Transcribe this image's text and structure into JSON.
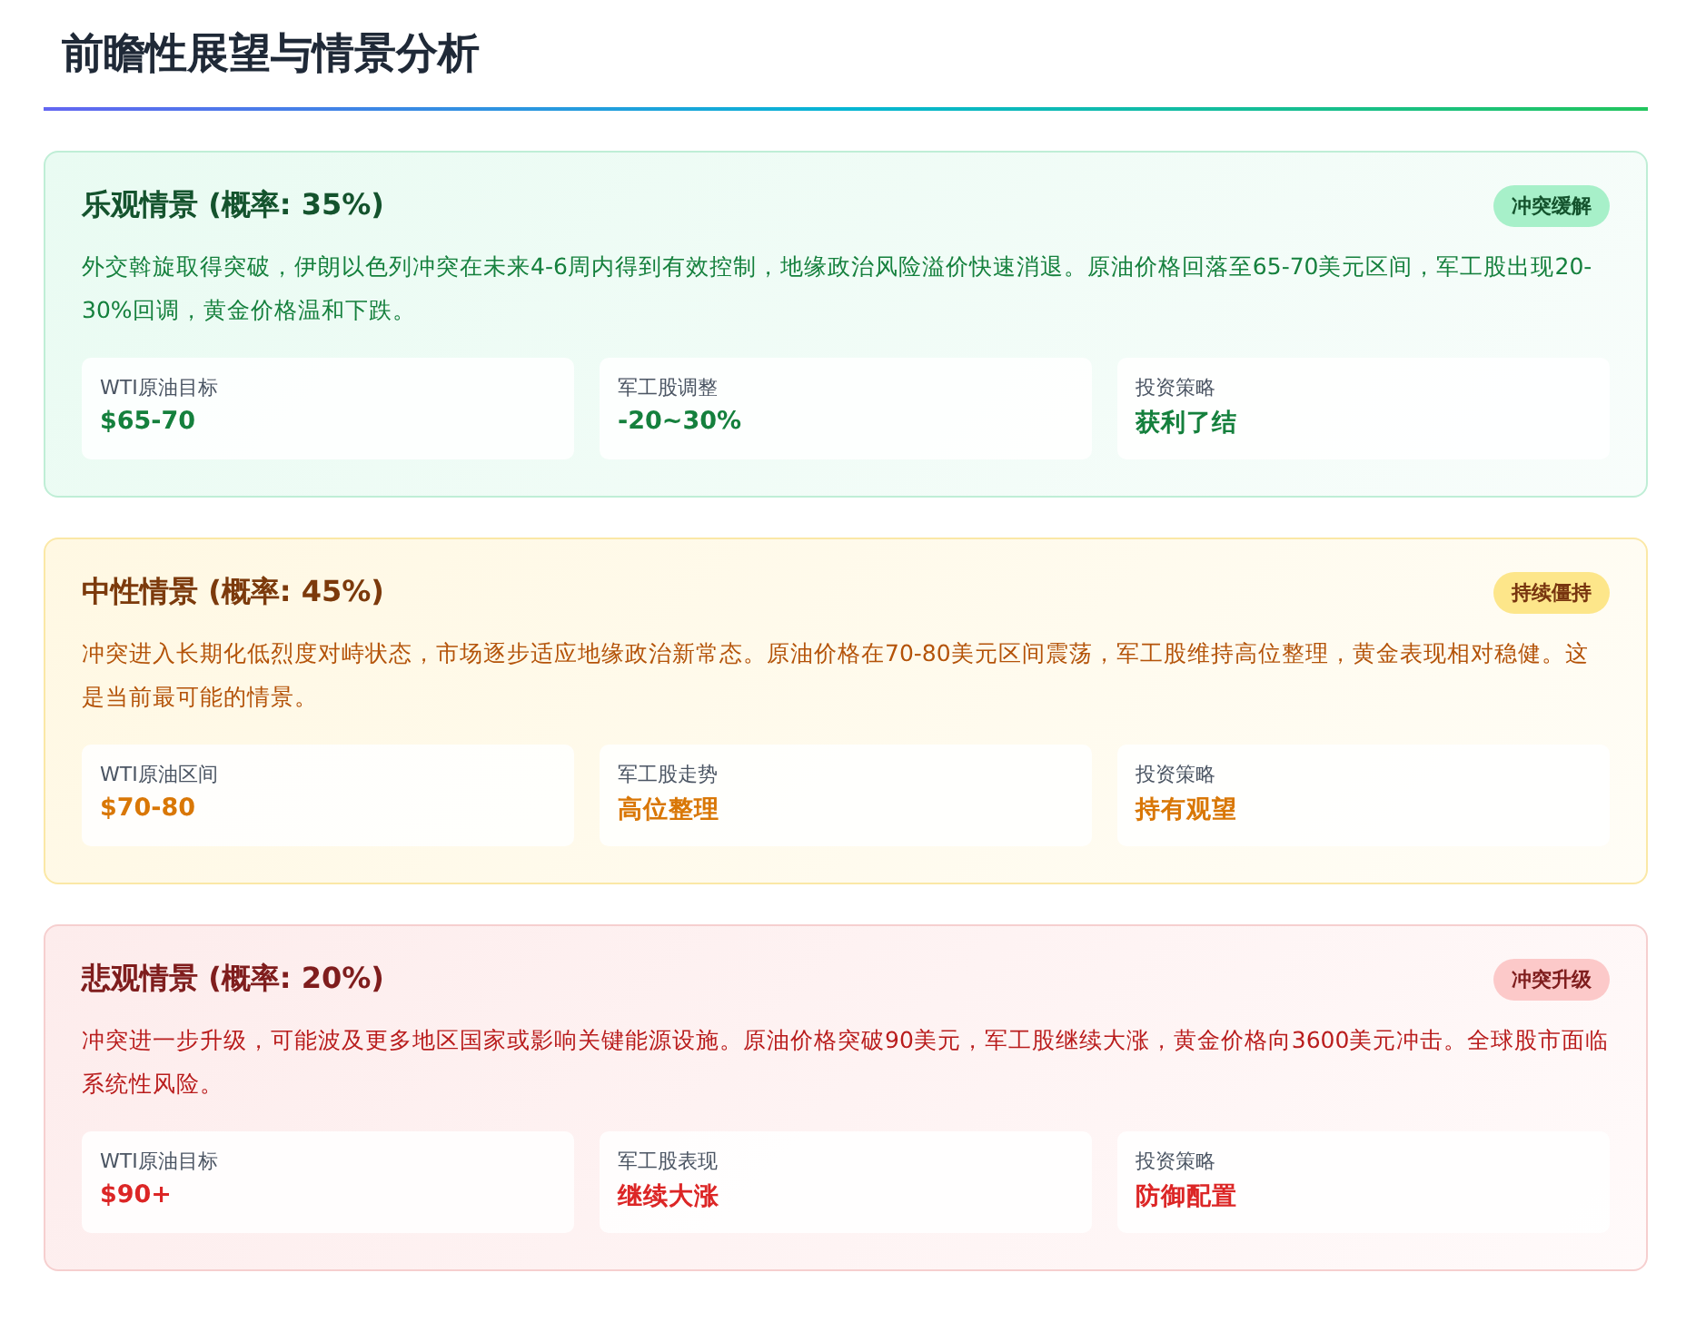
{
  "title": "前瞻性展望与情景分析",
  "scenarios": [
    {
      "kind": "optimistic",
      "title": "乐观情景 (概率: 35%)",
      "badge": "冲突缓解",
      "description": "外交斡旋取得突破，伊朗以色列冲突在未来4-6周内得到有效控制，地缘政治风险溢价快速消退。原油价格回落至65-70美元区间，军工股出现20-30%回调，黄金价格温和下跌。",
      "metrics": [
        {
          "label": "WTI原油目标",
          "value": "$65-70"
        },
        {
          "label": "军工股调整",
          "value": "-20~30%"
        },
        {
          "label": "投资策略",
          "value": "获利了结"
        }
      ]
    },
    {
      "kind": "neutral",
      "title": "中性情景 (概率: 45%)",
      "badge": "持续僵持",
      "description": "冲突进入长期化低烈度对峙状态，市场逐步适应地缘政治新常态。原油价格在70-80美元区间震荡，军工股维持高位整理，黄金表现相对稳健。这是当前最可能的情景。",
      "metrics": [
        {
          "label": "WTI原油区间",
          "value": "$70-80"
        },
        {
          "label": "军工股走势",
          "value": "高位整理"
        },
        {
          "label": "投资策略",
          "value": "持有观望"
        }
      ]
    },
    {
      "kind": "pessimistic",
      "title": "悲观情景 (概率: 20%)",
      "badge": "冲突升级",
      "description": "冲突进一步升级，可能波及更多地区国家或影响关键能源设施。原油价格突破90美元，军工股继续大涨，黄金价格向3600美元冲击。全球股市面临系统性风险。",
      "metrics": [
        {
          "label": "WTI原油目标",
          "value": "$90+"
        },
        {
          "label": "军工股表现",
          "value": "继续大涨"
        },
        {
          "label": "投资策略",
          "value": "防御配置"
        }
      ]
    }
  ]
}
